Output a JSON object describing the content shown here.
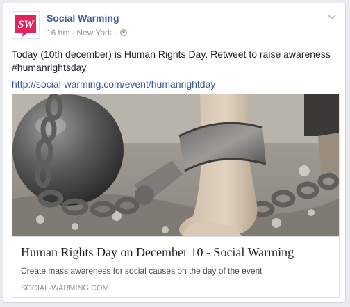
{
  "post": {
    "page_name": "Social Warming",
    "time": "16 hrs",
    "separator": "·",
    "location": "New York",
    "privacy_icon": "globe-icon",
    "menu_icon": "chevron-down-icon",
    "text_line1": "Today (10th december) is Human Rights Day. Retweet to raise awareness",
    "text_line2": "#humanrightsday",
    "link": "http://social-warming.com/event/humanrightday"
  },
  "logo": {
    "text": "SW",
    "color": "#e0245e"
  },
  "attachment": {
    "title": "Human Rights Day on December 10 - Social Warming",
    "description": "Create mass awareness for social causes on the day of the event",
    "domain": "SOCIAL-WARMING.COM"
  },
  "colors": {
    "link": "#365899",
    "name": "#3b5998",
    "meta": "#90949c"
  }
}
